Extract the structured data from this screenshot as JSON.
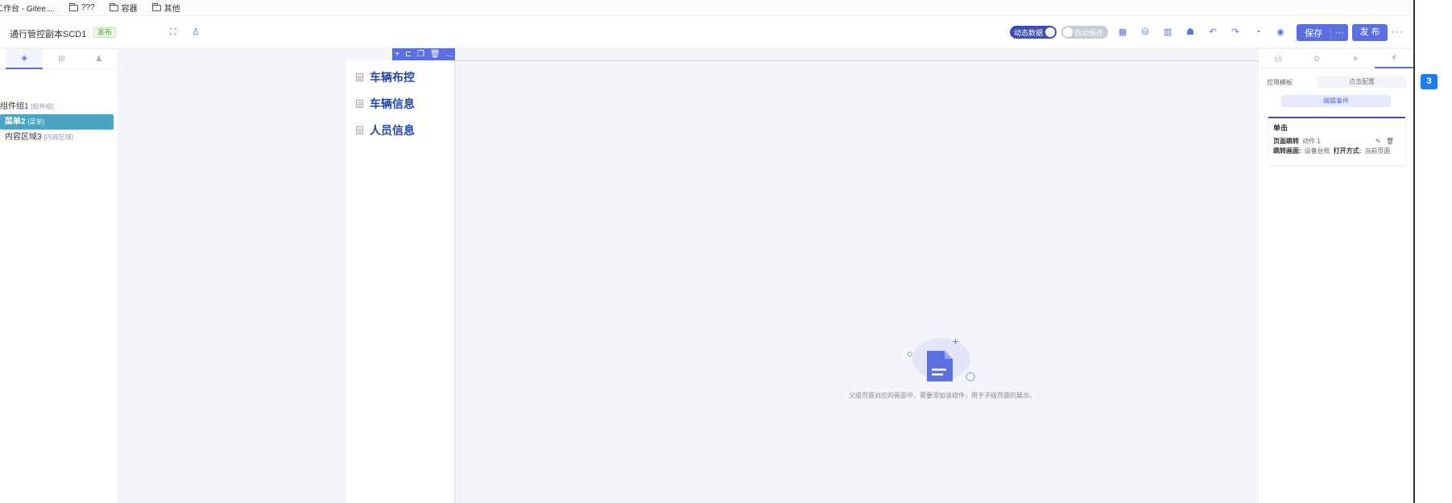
{
  "bookmarks": [
    {
      "label": "工作台 - Gitee...."
    },
    {
      "label": "???"
    },
    {
      "label": "容器"
    },
    {
      "label": "其他"
    }
  ],
  "header": {
    "title": "通行管控副本SCD1",
    "publish_badge": "发布",
    "dynamic_data_label": "动态数据",
    "auto_save_label": "自动保存",
    "save_label": "保存",
    "save_more": "···",
    "publish_label": "发 布",
    "more_label": "···"
  },
  "left_panel": {
    "tree": [
      {
        "label": "组件组1",
        "sub": "[组件组]"
      },
      {
        "label": "菜单2",
        "sub": "[菜单]"
      },
      {
        "label": "内容区域3",
        "sub": "[内容区域]"
      }
    ]
  },
  "canvas": {
    "toolbar_more": "...",
    "menu_items": [
      {
        "label": "车辆布控"
      },
      {
        "label": "车辆信息"
      },
      {
        "label": "人员信息"
      }
    ],
    "empty_text": "父级页面对应的画面中，需要添加该组件，用于子级页面的展示。"
  },
  "right_panel": {
    "template_label": "应用模板",
    "template_value": "点击配置",
    "edit_event_label": "编辑事件",
    "event_card": {
      "title": "单击",
      "action_type": "页面跳转",
      "action_name": "动作 1",
      "target_label": "跳转画面:",
      "target_value": "设备台账",
      "open_label": "打开方式:",
      "open_value": "当前页面"
    }
  },
  "badge_number": "3",
  "colors": {
    "accent": "#5b70e0",
    "toggle_on": "#3b4fb0",
    "selected_node": "#4aa4c4",
    "menu_text": "#1f45a8",
    "badge": "#1e7cf0"
  }
}
